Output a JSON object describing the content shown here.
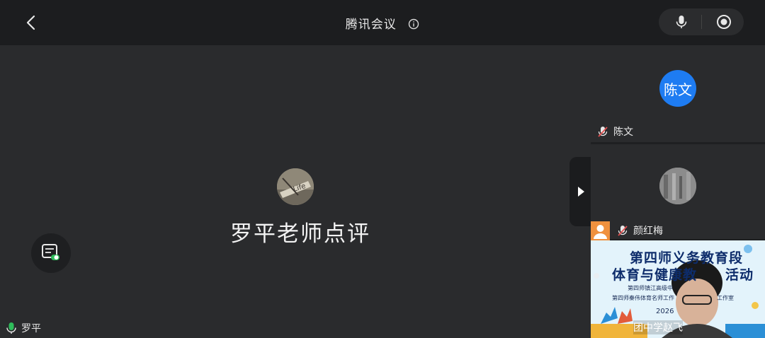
{
  "header": {
    "title": "腾讯会议"
  },
  "main": {
    "presenter_title": "罗平老师点评",
    "avatar_text": "Life",
    "speaker_name": "罗平"
  },
  "panel": {
    "participants": [
      {
        "avatar_text": "陈文",
        "name": "陈文",
        "avatar_color": "#1e7cf2",
        "muted": true
      },
      {
        "name": "颜红梅",
        "muted": true
      }
    ],
    "video_tile": {
      "line1": "第四师义务教育段",
      "line2": "体育与健康教",
      "line2_end": "活动",
      "small1": "第四师镇江高级中",
      "small2": "第四师秦伟体育名师工作",
      "small2_end": "工作室",
      "year": "2026",
      "footer": "团中学赵飞"
    }
  },
  "colors": {
    "accent_blue": "#1e7cf2",
    "mic_green": "#2fbd5b",
    "muted_red": "#e35050"
  }
}
